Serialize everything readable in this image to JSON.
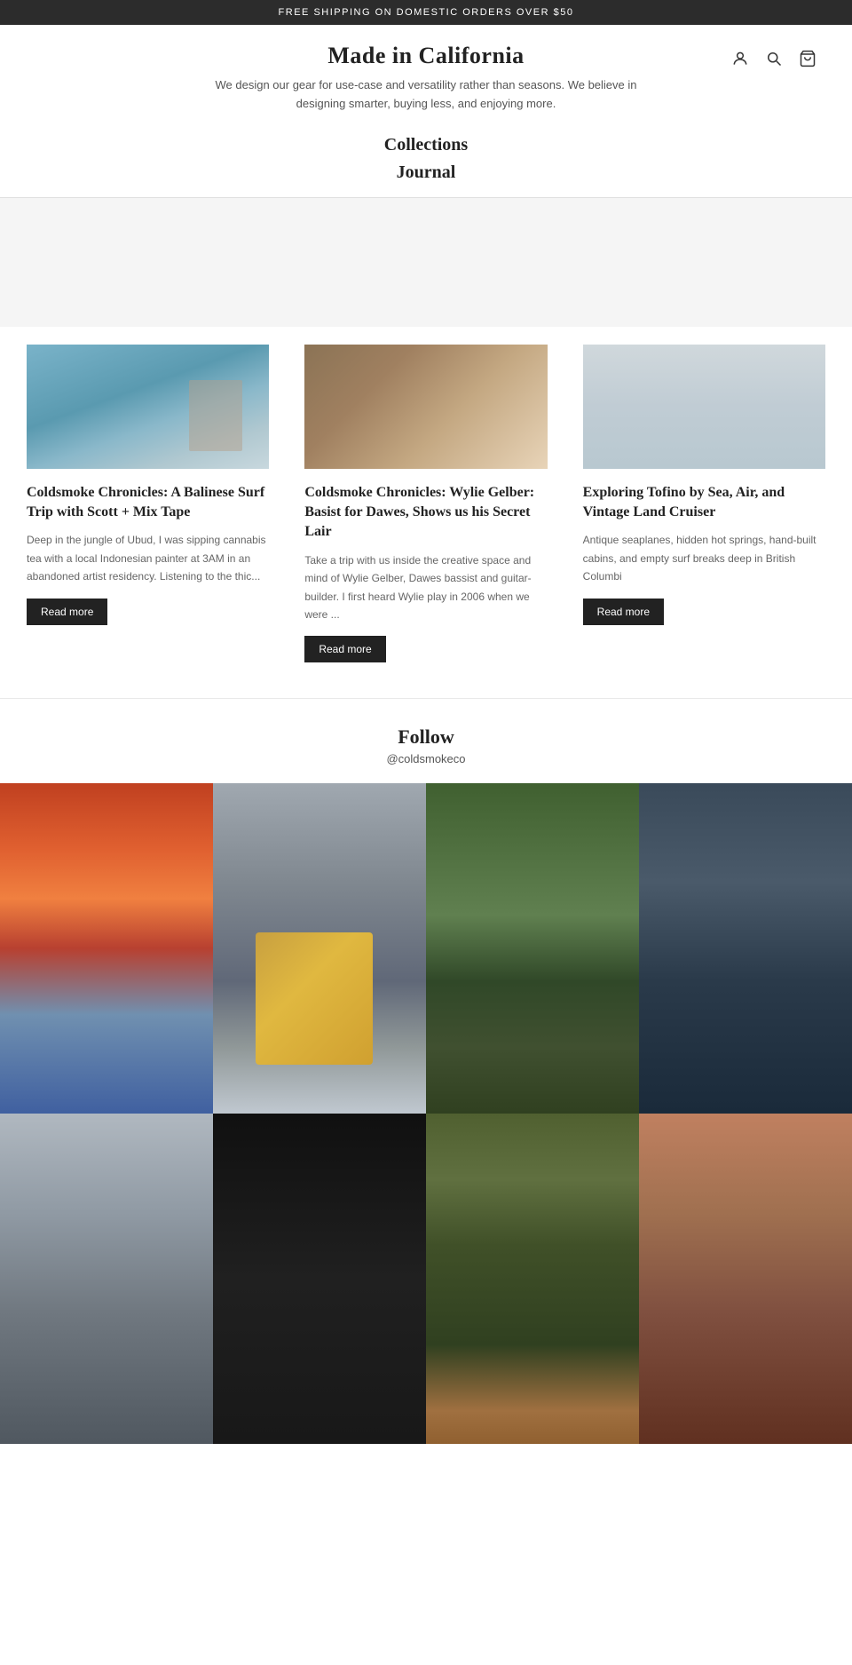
{
  "banner": {
    "text": "FREE SHIPPING ON DOMESTIC ORDERS OVER $50"
  },
  "header": {
    "brand": "Made in California",
    "tagline": "We design our gear for use-case and versatility rather than seasons. We believe in designing smarter, buying less, and enjoying more.",
    "icons": {
      "user": "👤",
      "search": "🔍",
      "cart": "🛒"
    }
  },
  "nav": {
    "items": [
      {
        "label": "Collections"
      },
      {
        "label": "Journal"
      }
    ]
  },
  "articles": [
    {
      "title": "Coldsmoke Chronicles: A Balinese Surf Trip with Scott + Mix Tape",
      "excerpt": "Deep in the jungle of Ubud, I was sipping cannabis tea with a local Indonesian painter at 3AM in an abandoned artist residency. Listening to the thic...",
      "read_more": "Read more"
    },
    {
      "title": "Coldsmoke Chronicles: Wylie Gelber: Basist for Dawes, Shows us his Secret Lair",
      "excerpt": "Take a trip with us inside the creative space and mind of Wylie Gelber, Dawes bassist and guitar-builder.  I first heard Wylie play in 2006 when we were ...",
      "read_more": "Read more"
    },
    {
      "title": "Exploring Tofino by Sea, Air, and Vintage Land Cruiser",
      "excerpt": "Antique seaplanes, hidden hot springs, hand-built cabins, and empty surf breaks deep in British Columbi",
      "read_more": "Read more"
    }
  ],
  "follow": {
    "title": "Follow",
    "handle": "@coldsmokeco"
  },
  "instagram": {
    "cells": [
      {
        "id": "ig-1",
        "class": "ig-1"
      },
      {
        "id": "ig-2",
        "class": "ig-2"
      },
      {
        "id": "ig-3",
        "class": "ig-3"
      },
      {
        "id": "ig-4",
        "class": "ig-4"
      },
      {
        "id": "ig-5",
        "class": "ig-5"
      },
      {
        "id": "ig-6",
        "class": "ig-6"
      },
      {
        "id": "ig-7",
        "class": "ig-7"
      },
      {
        "id": "ig-8",
        "class": "ig-8"
      }
    ]
  }
}
